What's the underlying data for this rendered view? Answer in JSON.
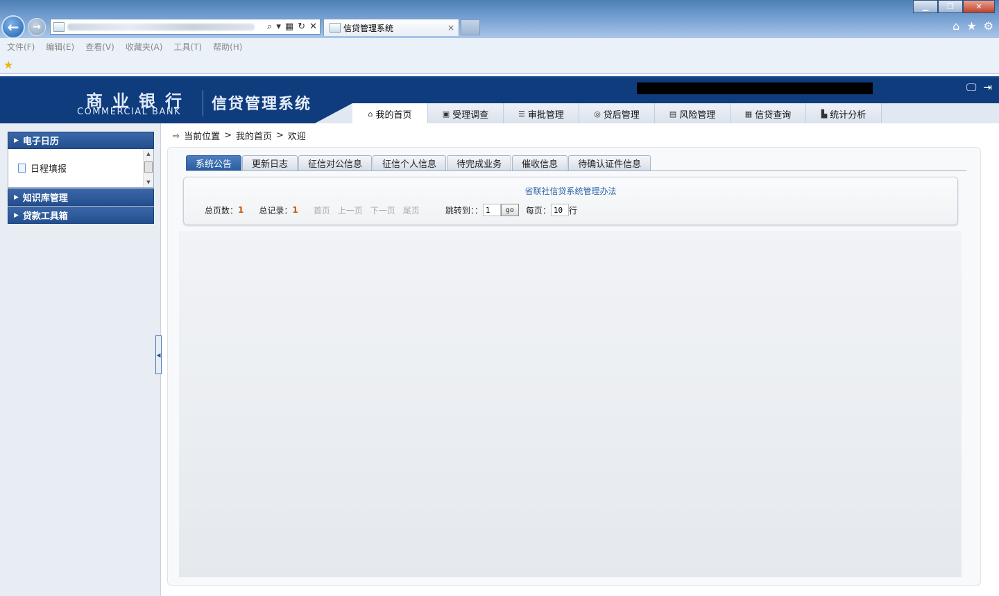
{
  "browser": {
    "tab_title": "信贷管理系统",
    "tab_close": "×",
    "menu": [
      "文件(F)",
      "编辑(E)",
      "查看(V)",
      "收藏夹(A)",
      "工具(T)",
      "帮助(H)"
    ],
    "window_buttons": {
      "minimize": "▁",
      "restore": "❐",
      "close": "✕"
    },
    "back_icon": "←",
    "forward_icon": "→",
    "favorites_icon": "★"
  },
  "header": {
    "logo_cn": "商业银行",
    "logo_en": "COMMERCIAL BANK",
    "system_title": "信贷管理系统",
    "nav": [
      {
        "label": "我的首页",
        "icon": "⌂",
        "active": true
      },
      {
        "label": "受理调查",
        "icon": "▣"
      },
      {
        "label": "审批管理",
        "icon": "☰"
      },
      {
        "label": "贷后管理",
        "icon": "◎"
      },
      {
        "label": "风险管理",
        "icon": "▤"
      },
      {
        "label": "信贷查询",
        "icon": "▦"
      },
      {
        "label": "统计分析",
        "icon": "▙"
      }
    ]
  },
  "sidebar": {
    "panels": [
      {
        "title": "电子日历"
      },
      {
        "title": "知识库管理"
      },
      {
        "title": "贷款工具箱"
      }
    ],
    "calendar_items": [
      {
        "label": "日程填报"
      }
    ]
  },
  "breadcrumb": {
    "items": [
      "当前位置",
      "我的首页",
      "欢迎"
    ],
    "separator": ">"
  },
  "subtabs": [
    {
      "label": "系统公告",
      "active": true
    },
    {
      "label": "更新日志"
    },
    {
      "label": "征信对公信息"
    },
    {
      "label": "征信个人信息"
    },
    {
      "label": "待完成业务"
    },
    {
      "label": "催收信息"
    },
    {
      "label": "待确认证件信息"
    }
  ],
  "notice": {
    "link": "省联社信贷系统管理办法",
    "pager": {
      "total_pages_label": "总页数：",
      "total_pages": "1",
      "total_records_label": "总记录：",
      "total_records": "1",
      "first": "首页",
      "prev": "上一页",
      "next": "下一页",
      "last": "尾页",
      "jump_label": "跳转到：：",
      "jump_value": "1",
      "go": "go",
      "per_page_label": "每页：",
      "per_page_value": "10",
      "rows_unit": "行"
    }
  }
}
